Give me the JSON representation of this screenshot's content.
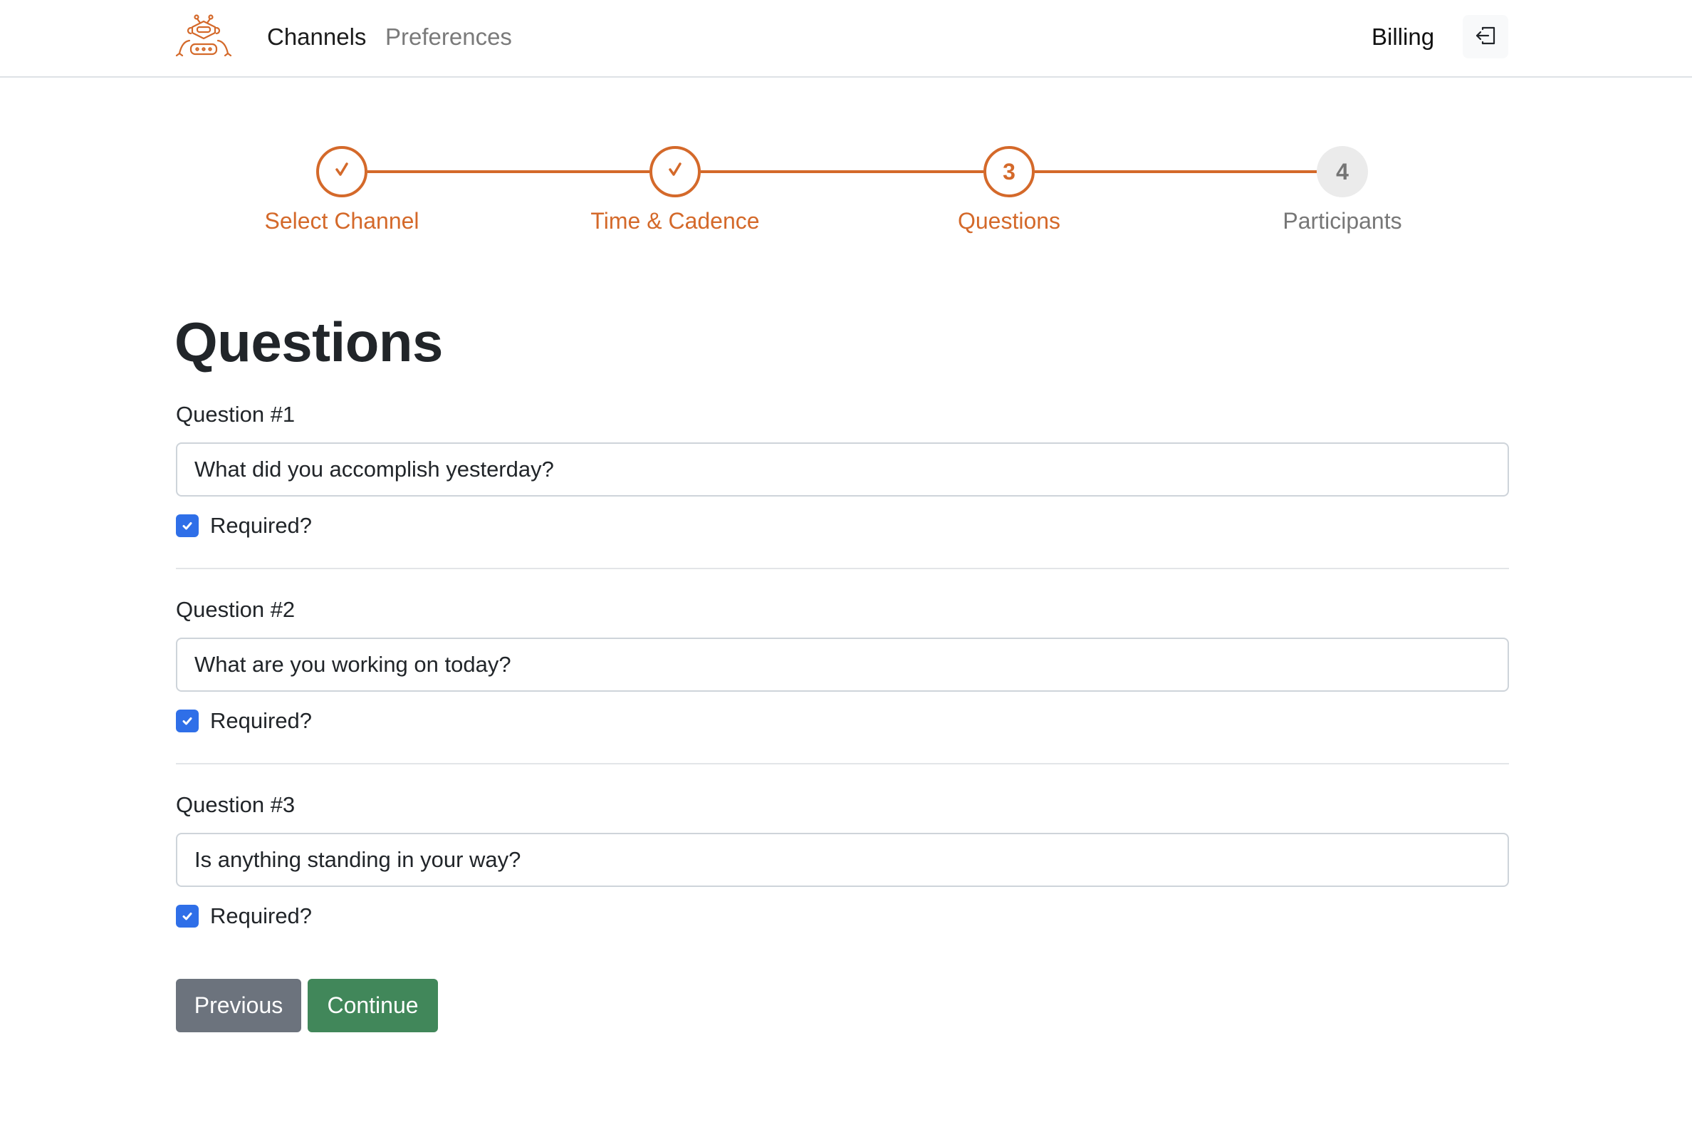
{
  "navbar": {
    "logo_icon": "robot-icon",
    "links": [
      {
        "label": "Channels",
        "active": true
      },
      {
        "label": "Preferences",
        "active": false
      }
    ],
    "billing_label": "Billing",
    "logout_icon": "logout-icon"
  },
  "stepper": {
    "accent_color": "#d4692a",
    "steps": [
      {
        "number": "1",
        "label": "Select Channel",
        "state": "done",
        "icon": "check-icon"
      },
      {
        "number": "2",
        "label": "Time & Cadence",
        "state": "done",
        "icon": "check-icon"
      },
      {
        "number": "3",
        "label": "Questions",
        "state": "active"
      },
      {
        "number": "4",
        "label": "Participants",
        "state": "todo"
      }
    ]
  },
  "page": {
    "title": "Questions",
    "questions": [
      {
        "label": "Question #1",
        "value": "What did you accomplish yesterday?",
        "required_label": "Required?",
        "required": true
      },
      {
        "label": "Question #2",
        "value": "What are you working on today?",
        "required_label": "Required?",
        "required": true
      },
      {
        "label": "Question #3",
        "value": "Is anything standing in your way?",
        "required_label": "Required?",
        "required": true
      }
    ]
  },
  "actions": {
    "previous_label": "Previous",
    "continue_label": "Continue",
    "previous_color": "#6c737d",
    "continue_color": "#41875a"
  }
}
